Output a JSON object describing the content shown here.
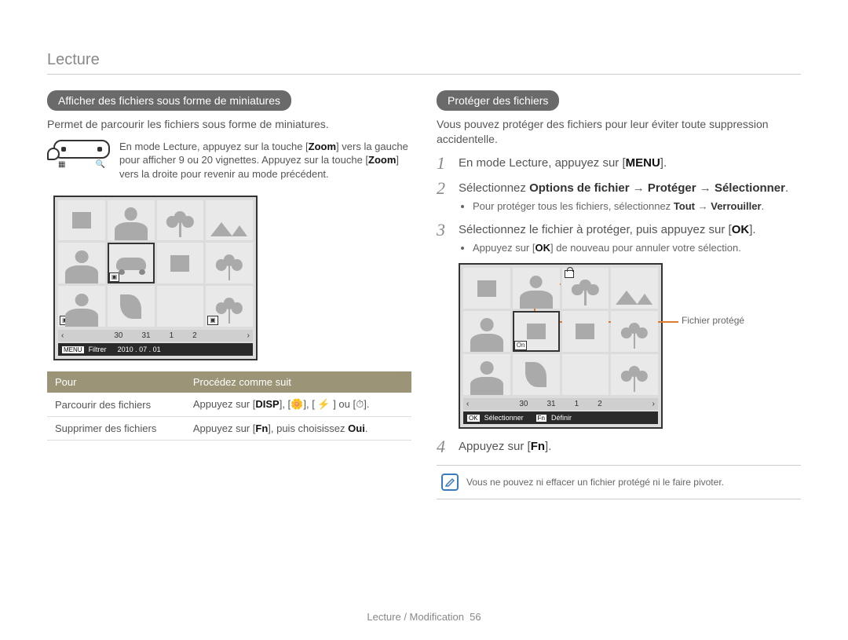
{
  "header": {
    "title": "Lecture"
  },
  "left": {
    "pill": "Afficher des fichiers sous forme de miniatures",
    "intro": "Permet de parcourir les fichiers sous forme de miniatures.",
    "zoom_text_1": "En mode Lecture, appuyez sur la touche [",
    "zoom_kw": "Zoom",
    "zoom_text_2": "] vers la gauche pour afficher 9 ou 20 vignettes. Appuyez sur la touche [",
    "zoom_text_3": "] vers la droite pour revenir au mode précédent.",
    "thumb_bar": {
      "nums": [
        "30",
        "31",
        "1",
        "2"
      ],
      "left_arrow": "‹",
      "right_arrow": "›"
    },
    "thumb_footer": {
      "menu_key": "MENU",
      "filter": "Filtrer",
      "date": "2010 . 07 . 01"
    },
    "table": {
      "h1": "Pour",
      "h2": "Procédez comme suit",
      "r1c1": "Parcourir des fichiers",
      "r1c2_pre": "Appuyez sur [",
      "r1c2_disp": "DISP",
      "r1c2_mid": "], [🌼], [ ⚡ ] ou [⏱].",
      "r2c1": "Supprimer des fichiers",
      "r2c2_pre": "Appuyez sur [",
      "r2c2_fn": "Fn",
      "r2c2_mid": "], puis choisissez ",
      "r2c2_oui": "Oui",
      "r2c2_end": "."
    }
  },
  "right": {
    "pill": "Protéger des fichiers",
    "intro": "Vous pouvez protéger des fichiers pour leur éviter toute suppression accidentelle.",
    "steps": {
      "s1_pre": "En mode Lecture, appuyez sur [",
      "s1_menu": "MENU",
      "s1_end": "].",
      "s2_pre": "Sélectionnez ",
      "s2_b1": "Options de fichier",
      "s2_arrow": " → ",
      "s2_b2": "Protéger",
      "s2_b3": "Sélectionner",
      "s2_bullet_pre": "Pour protéger tous les fichiers, sélectionnez ",
      "s2_bullet_b1": "Tout",
      "s2_bullet_b2": "Verrouiller",
      "s3_pre": "Sélectionnez le fichier à protéger, puis appuyez sur [",
      "s3_ok": "OK",
      "s3_end": "].",
      "s3_bullet_pre": "Appuyez sur [",
      "s3_bullet_end": "] de nouveau pour annuler votre sélection.",
      "s4_pre": "Appuyez sur [",
      "s4_fn": "Fn",
      "s4_end": "]."
    },
    "callout": "Fichier protégé",
    "thumb_bar": {
      "nums": [
        "30",
        "31",
        "1",
        "2"
      ]
    },
    "thumb_footer": {
      "ok": "OK",
      "select": "Sélectionner",
      "fn": "Fn",
      "define": "Définir"
    },
    "info": "Vous ne pouvez ni effacer un fichier protégé ni le faire pivoter."
  },
  "footer": {
    "section": "Lecture / Modification",
    "page": "56"
  }
}
